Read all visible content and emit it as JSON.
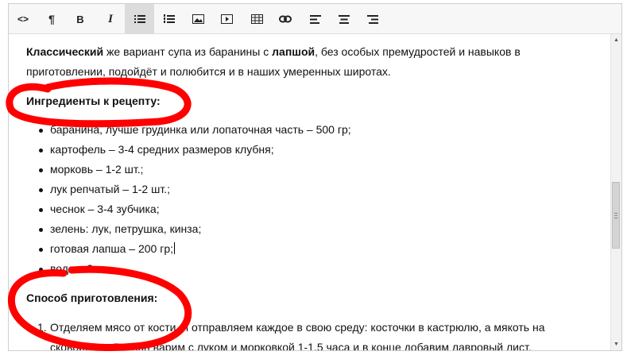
{
  "toolbar": {
    "buttons": [
      {
        "name": "code-view-button",
        "icon": "code-icon",
        "glyph": "<>"
      },
      {
        "name": "paragraph-button",
        "icon": "pilcrow-icon",
        "glyph": "¶"
      },
      {
        "name": "bold-button",
        "icon": "bold-icon",
        "glyph": "B"
      },
      {
        "name": "italic-button",
        "icon": "italic-icon",
        "glyph": "I"
      },
      {
        "name": "bullet-list-button",
        "icon": "bullet-list-icon",
        "active": true
      },
      {
        "name": "numbered-list-button",
        "icon": "numbered-list-icon"
      },
      {
        "name": "insert-image-button",
        "icon": "image-icon"
      },
      {
        "name": "insert-video-button",
        "icon": "video-icon"
      },
      {
        "name": "insert-table-button",
        "icon": "table-icon"
      },
      {
        "name": "insert-link-button",
        "icon": "link-icon"
      },
      {
        "name": "align-left-button",
        "icon": "align-left-icon"
      },
      {
        "name": "align-center-button",
        "icon": "align-center-icon"
      },
      {
        "name": "align-right-button",
        "icon": "align-right-icon"
      }
    ]
  },
  "content": {
    "intro": {
      "bold1": "Классический",
      "text1": " же вариант супа из баранины с ",
      "bold2": "лапшой",
      "text2": ", без особых премудростей и навыков в приготовлении, подойдёт и полюбится и в наших умеренных широтах."
    },
    "ingredients_heading": "Ингредиенты к рецепту:",
    "ingredients": [
      "баранина, лучше грудинка или лопаточная часть – 500 гр;",
      "картофель – 3-4 средних размеров клубня;",
      "морковь – 1-2 шт.;",
      "лук репчатый – 1-2 шт.;",
      "чеснок – 3-4 зубчика;",
      "зелень: лук, петрушка, кинза;",
      "готовая лапша – 200 гр;",
      "вода – 3 л."
    ],
    "method_heading": "Способ приготовления:",
    "steps": [
      {
        "num": "1.",
        "text": "Отделяем мясо от кости, и отправляем каждое в свою среду: косточки в кастрюлю, а мякоть на сковородку. Бульон варим с луком и морковкой 1-1,5 часа и в конце добавим лавровый лист,"
      }
    ]
  },
  "colors": {
    "annotation": "#ff0000",
    "toolbar_bg": "#f7f7f7",
    "active_button": "#dcdcdc"
  }
}
